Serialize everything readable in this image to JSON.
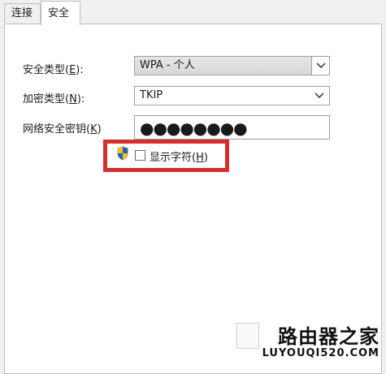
{
  "tabs": [
    {
      "label": "连接"
    },
    {
      "label": "安全"
    }
  ],
  "security_type": {
    "label_prefix": "安全类型(",
    "label_key": "E",
    "label_suffix": "):",
    "value": "WPA - 个人"
  },
  "encryption_type": {
    "label_prefix": "加密类型(",
    "label_key": "N",
    "label_suffix": "):",
    "value": "TKIP"
  },
  "network_key": {
    "label_prefix": "网络安全密钥(",
    "label_key": "K",
    "label_suffix": ")",
    "value": "●●●●●●●●"
  },
  "show_chars": {
    "label_prefix": "显示字符(",
    "label_key": "H",
    "label_suffix": ")",
    "checked": false
  },
  "watermark": {
    "brand": "路由器之家",
    "url": "LUYOUQI520.COM"
  },
  "colors": {
    "highlight": "#d42e2e"
  }
}
